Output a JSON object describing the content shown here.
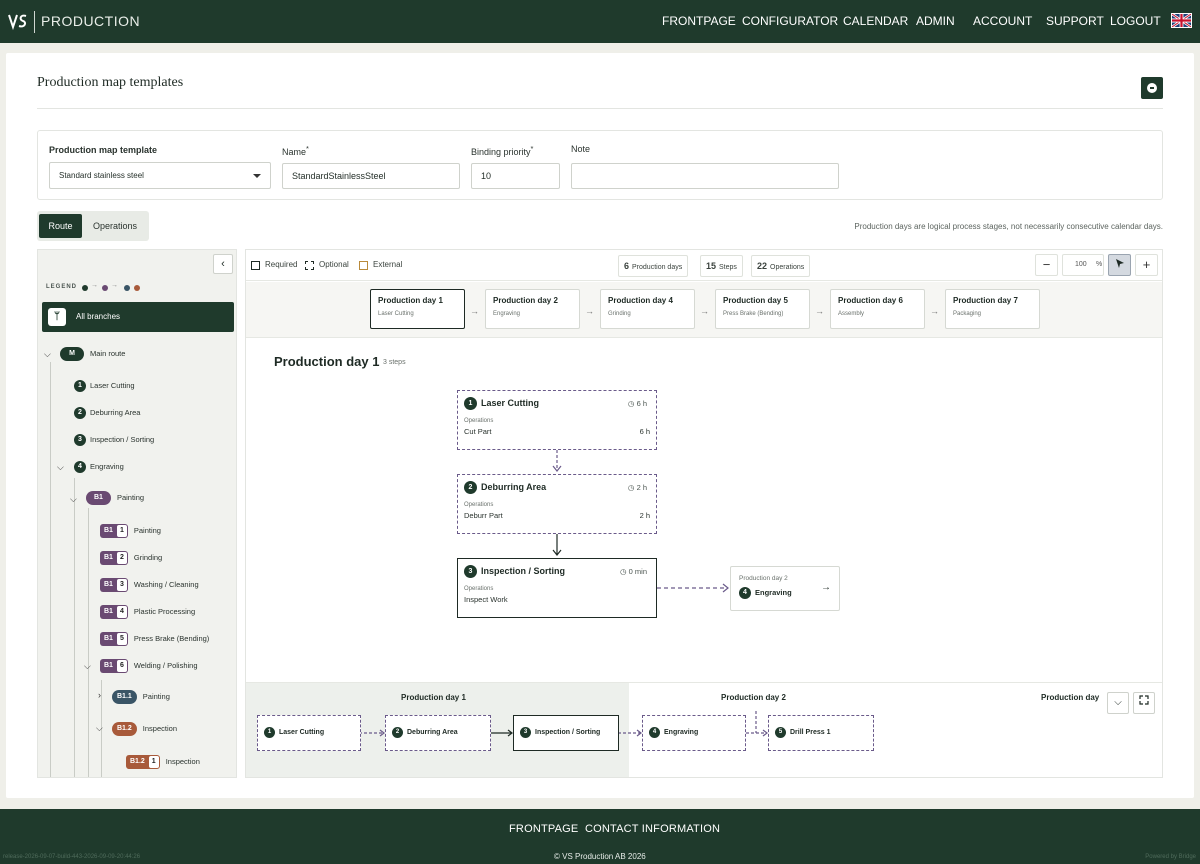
{
  "header": {
    "brand": "PRODUCTION",
    "nav": [
      "FRONTPAGE",
      "CONFIGURATOR",
      "CALENDAR",
      "ADMIN",
      "ACCOUNT",
      "SUPPORT",
      "LOGOUT"
    ],
    "language": "English"
  },
  "page": {
    "title": "Production map templates"
  },
  "form": {
    "template_label": "Production map template",
    "template_value": "Standard stainless steel",
    "name_label": "Name",
    "name_required": "*",
    "name_value": "StandardStainlessSteel",
    "priority_label": "Binding priority",
    "priority_required": "*",
    "priority_value": "10",
    "note_label": "Note",
    "note_value": ""
  },
  "tabs": {
    "route": "Route",
    "operations": "Operations",
    "active": "Route"
  },
  "hint": "Production days are logical process stages, not necessarily consecutive calendar days.",
  "sidebar": {
    "legend": "LEGEND",
    "all_branches": "All branches",
    "main_badge": "M",
    "main_route": "Main route",
    "items": [
      {
        "n": "1",
        "label": "Laser Cutting"
      },
      {
        "n": "2",
        "label": "Deburring Area"
      },
      {
        "n": "3",
        "label": "Inspection / Sorting"
      },
      {
        "n": "4",
        "label": "Engraving"
      }
    ],
    "branch": {
      "badge": "B1",
      "label": "Painting"
    },
    "branch_items": [
      {
        "n": "1",
        "label": "Painting"
      },
      {
        "n": "2",
        "label": "Grinding"
      },
      {
        "n": "3",
        "label": "Washing / Cleaning"
      },
      {
        "n": "4",
        "label": "Plastic Processing"
      },
      {
        "n": "5",
        "label": "Press Brake (Bending)"
      },
      {
        "n": "6",
        "label": "Welding / Polishing"
      }
    ],
    "sub1": {
      "badge": "B1.1",
      "label": "Painting"
    },
    "sub2": {
      "badge": "B1.2",
      "label": "Inspection"
    },
    "sub2_item": {
      "n": "1",
      "label": "Inspection"
    }
  },
  "canvas": {
    "legend_required": "Required",
    "legend_optional": "Optional",
    "legend_external": "External",
    "stat_days_n": "6",
    "stat_days": "Production days",
    "stat_steps_n": "15",
    "stat_steps": "Steps",
    "stat_ops_n": "22",
    "stat_ops": "Operations",
    "zoom": "100",
    "zoom_unit": "%"
  },
  "days": [
    {
      "title": "Production day 1",
      "sub": "Laser Cutting"
    },
    {
      "title": "Production day 2",
      "sub": "Engraving"
    },
    {
      "title": "Production day 4",
      "sub": "Grinding"
    },
    {
      "title": "Production day 5",
      "sub": "Press Brake (Bending)"
    },
    {
      "title": "Production day 6",
      "sub": "Assembly"
    },
    {
      "title": "Production day 7",
      "sub": "Packaging"
    }
  ],
  "section": {
    "title": "Production day 1",
    "sub": "3 steps"
  },
  "steps": [
    {
      "n": "1",
      "title": "Laser Cutting",
      "time": "6 h",
      "ops_label": "Operations",
      "op": "Cut Part",
      "op_time": "6 h"
    },
    {
      "n": "2",
      "title": "Deburring Area",
      "time": "2 h",
      "ops_label": "Operations",
      "op": "Deburr Part",
      "op_time": "2 h"
    },
    {
      "n": "3",
      "title": "Inspection / Sorting",
      "time": "0 min",
      "ops_label": "Operations",
      "op": "Inspect Work",
      "op_time": ""
    }
  ],
  "next": {
    "day": "Production day 2",
    "n": "4",
    "label": "Engraving"
  },
  "minimap": {
    "h1": "Production day 1",
    "h2": "Production day 2",
    "h3": "Production day",
    "nodes": [
      {
        "n": "1",
        "label": "Laser Cutting"
      },
      {
        "n": "2",
        "label": "Deburring Area"
      },
      {
        "n": "3",
        "label": "Inspection / Sorting"
      },
      {
        "n": "4",
        "label": "Engraving"
      },
      {
        "n": "5",
        "label": "Drill Press 1"
      }
    ]
  },
  "footer": {
    "link1": "FRONTPAGE",
    "link2": "CONTACT INFORMATION",
    "copyright": "© VS Production AB 2026",
    "version": "release-2026-09-07-build-443-2026-09-09-20:44:26",
    "powered": "Powered by Bridge"
  },
  "colors": {
    "brand": "#1f3a2c",
    "branch": "#6a4a72",
    "sub1": "#3a5566",
    "sub2": "#a85a3a",
    "dashed": "#6a5a8a"
  }
}
